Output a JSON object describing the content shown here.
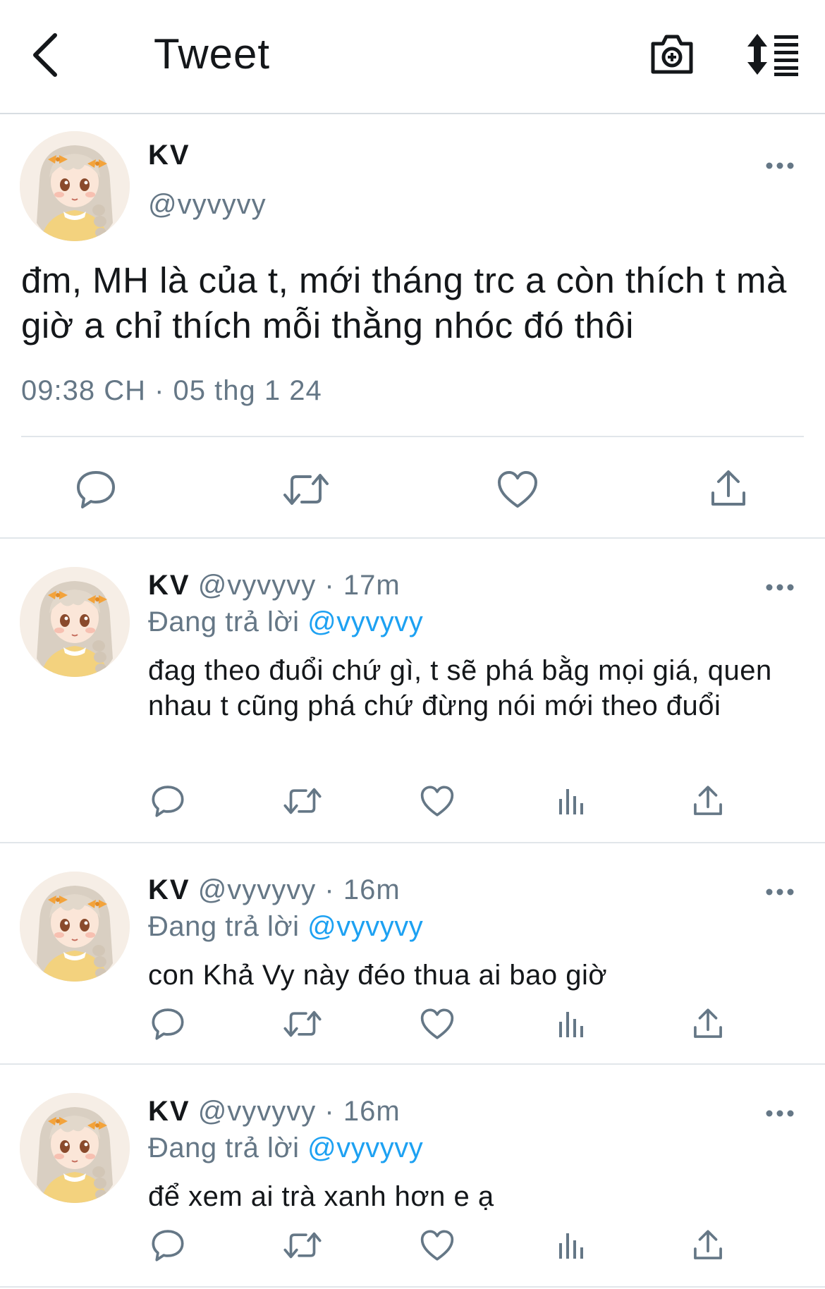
{
  "header": {
    "title": "Tweet",
    "back_icon": "chevron-left-icon",
    "camera_icon": "camera-plus-icon",
    "sort_icon": "sort-list-icon"
  },
  "main_tweet": {
    "name": "KV",
    "handle": "@vyvyvy",
    "text": "đm, MH là của t, mới tháng trc a còn thích t mà giờ a chỉ thích mỗi thằng nhóc đó thôi",
    "timestamp": "09:38 CH · 05 thg 1 24",
    "actions": [
      "reply-icon",
      "retweet-icon",
      "like-icon",
      "share-icon"
    ]
  },
  "replies": [
    {
      "name": "KV",
      "meta": "@vyvyvy · 17m",
      "replying_prefix": "Đang trả lời",
      "replying_to": "@vyvyvy",
      "text": "đag theo đuổi chứ gì, t sẽ phá bằg mọi giá, quen nhau t cũng phá chứ đừng nói mới theo đuổi"
    },
    {
      "name": "KV",
      "meta": "@vyvyvy · 16m",
      "replying_prefix": "Đang trả lời",
      "replying_to": "@vyvyvy",
      "text": "con Khả Vy này đéo thua ai bao giờ"
    },
    {
      "name": "KV",
      "meta": "@vyvyvy · 16m",
      "replying_prefix": "Đang trả lời",
      "replying_to": "@vyvyvy",
      "text": "để xem ai trà xanh hơn e ạ"
    }
  ],
  "colors": {
    "text": "#14171a",
    "secondary": "#657786",
    "accent": "#1da1f2",
    "divider": "#e1e6ea"
  }
}
